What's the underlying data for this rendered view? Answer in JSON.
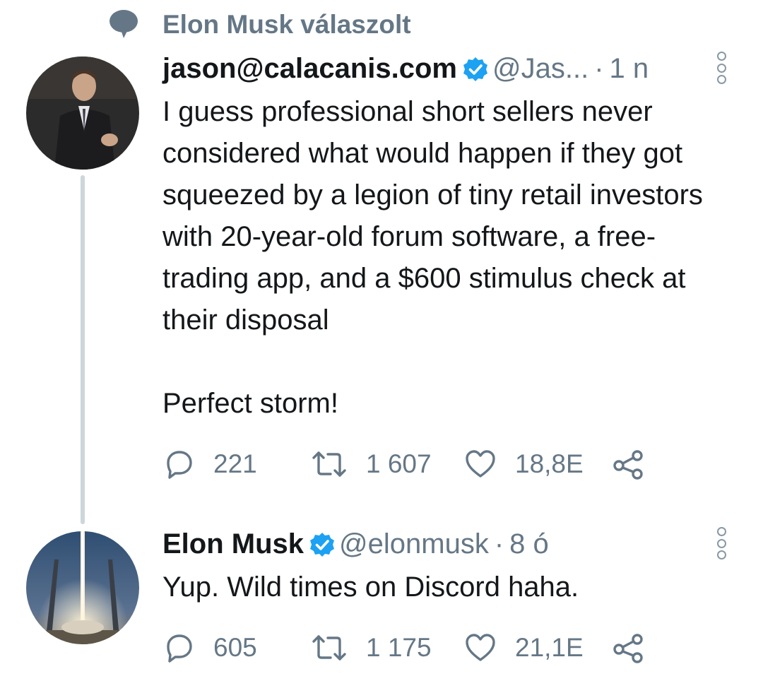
{
  "context": {
    "label": "Elon Musk válaszolt",
    "icon": "speech-bubble-icon"
  },
  "tweets": [
    {
      "author_name": "jason@calacanis.com",
      "verified": true,
      "handle": "@Jas...",
      "separator": "·",
      "time": "1 n",
      "body": [
        "I guess professional short sellers never considered what would happen if they got squeezed by a legion of tiny retail investors with 20-year-old forum software, a free-trading app, and a $600 stimulus check at their disposal",
        "Perfect storm!"
      ],
      "stats": {
        "replies": "221",
        "retweets": "1 607",
        "likes": "18,8E"
      }
    },
    {
      "author_name": "Elon Musk",
      "verified": true,
      "handle": "@elonmusk",
      "separator": "·",
      "time": "8 ó",
      "body": [
        "Yup. Wild times on Discord haha."
      ],
      "stats": {
        "replies": "605",
        "retweets": "1 175",
        "likes": "21,1E"
      }
    }
  ],
  "colors": {
    "text": "#14171a",
    "secondary": "#657786",
    "verified": "#1da1f2",
    "thread_line": "#ccd6dd"
  },
  "icons": [
    "speech-bubble-icon",
    "verified-badge-icon",
    "more-options-icon",
    "reply-icon",
    "retweet-icon",
    "like-icon",
    "share-icon"
  ]
}
